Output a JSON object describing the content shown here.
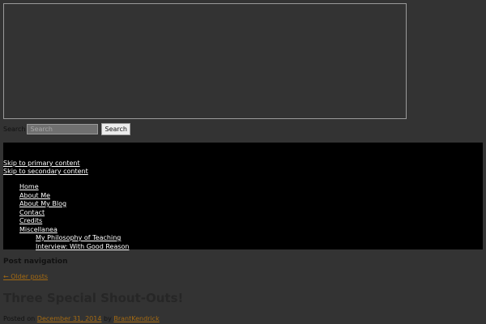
{
  "search": {
    "label": "Search",
    "placeholder": "Search",
    "button_label": "Search"
  },
  "skip_links": {
    "primary": "Skip to primary content",
    "secondary": "Skip to secondary content"
  },
  "menu": {
    "items": [
      {
        "label": "Home"
      },
      {
        "label": "About Me"
      },
      {
        "label": "About My Blog"
      },
      {
        "label": "Contact"
      },
      {
        "label": "Credits"
      },
      {
        "label": "Miscellanea"
      }
    ],
    "sub_items": [
      {
        "label": "My Philosophy of Teaching"
      },
      {
        "label": "Interview: With Good Reason"
      }
    ]
  },
  "post_navigation": {
    "heading": "Post navigation",
    "older_link": "← Older posts"
  },
  "post": {
    "title": "Three Special Shout-Outs!",
    "posted_prefix": "Posted on",
    "date": "December 31, 2014",
    "by_word": "by",
    "author": "BrantKendrick"
  },
  "colors": {
    "background": "#333333",
    "band": "#000000",
    "link_accent": "#a46a12"
  }
}
